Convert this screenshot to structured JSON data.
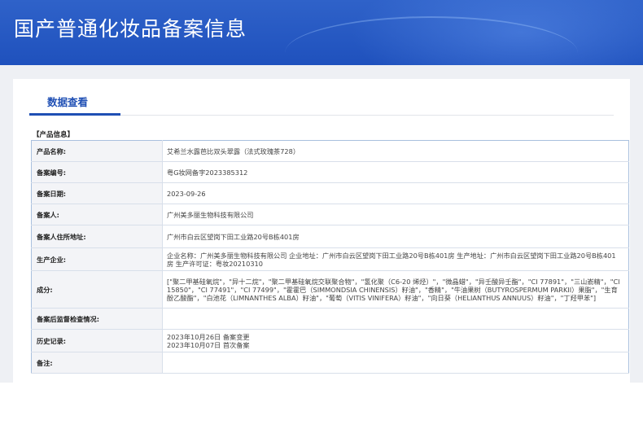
{
  "header": {
    "title": "国产普通化妆品备案信息"
  },
  "tabs": [
    {
      "label": "数据查看",
      "active": true
    }
  ],
  "section": {
    "title": "【产品信息】"
  },
  "rows": [
    {
      "label": "产品名称:",
      "value": "艾希兰水露芭比双头翠露（法式玫瑰茶728）"
    },
    {
      "label": "备案编号:",
      "value": "粤G妆网备字2023385312"
    },
    {
      "label": "备案日期:",
      "value": "2023-09-26"
    },
    {
      "label": "备案人:",
      "value": "广州美多丽生物科技有限公司"
    },
    {
      "label": "备案人住所地址:",
      "value": "广州市白云区望岗下田工业路20号B栋401房"
    },
    {
      "label": "生产企业:",
      "value": "企业名称：广州美多丽生物科技有限公司 企业地址：广州市白云区望岗下田工业路20号B栋401房 生产地址：广州市白云区望岗下田工业路20号B栋401房 生产许可证：粤妆20210310"
    },
    {
      "label": "成分:",
      "value": "[\"聚二甲基硅氧烷\"，\"异十二烷\"，\"聚二甲基硅氧烷交联聚合物\"，\"氢化聚（C6-20 烯烃）\"，\"微晶蜡\"，\"异壬酸异壬酯\"，\"CI 77891\"，\"三山嵛精\"，\"CI 15850\"，\"CI 77491\"，\"CI 77499\"，\"霍霍巴（SIMMONDSIA CHINENSIS）籽油\"，\"香精\"，\"牛油果树（BUTYROSPERMUM PARKII）果脂\"，\"生育酚乙酸酯\"，\"白池花（LIMNANTHES ALBA）籽油\"，\"葡萄（VITIS VINIFERA）籽油\"，\"向日葵（HELIANTHUS ANNUUS）籽油\"，\"丁羟甲苯\"]"
    },
    {
      "label": "备案后监督检查情况:",
      "value": ""
    },
    {
      "label": "历史记录:",
      "value": "2023年10月26日 备案变更\n2023年10月07日 首次备案"
    },
    {
      "label": "备注:",
      "value": ""
    }
  ]
}
